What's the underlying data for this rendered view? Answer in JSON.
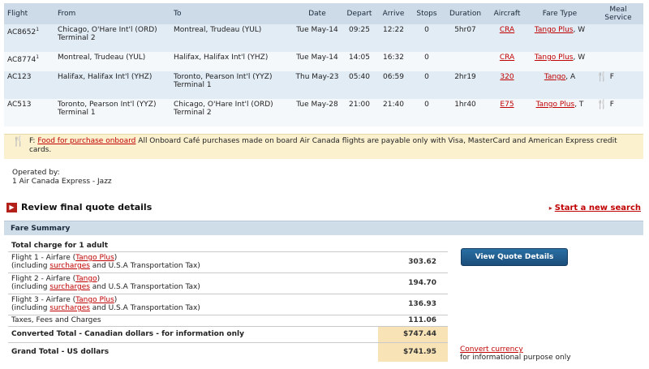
{
  "flights": {
    "headers": [
      "Flight",
      "From",
      "To",
      "Date",
      "Depart",
      "Arrive",
      "Stops",
      "Duration",
      "Aircraft",
      "Fare Type",
      "Meal Service"
    ],
    "rows": [
      {
        "flight": "AC8652",
        "sup": "1",
        "from": "Chicago, O'Hare Int'l (ORD)",
        "from2": "Terminal 2",
        "to": "Montreal, Trudeau (YUL)",
        "to2": "",
        "date": "Tue May-14",
        "depart": "09:25",
        "arrive": "12:22",
        "stops": "0",
        "duration": "5hr07",
        "aircraft": "CRA",
        "fare": "Tango Plus",
        "fare_class": ", W",
        "meal": ""
      },
      {
        "flight": "AC8774",
        "sup": "1",
        "from": "Montreal, Trudeau (YUL)",
        "from2": "",
        "to": "Halifax, Halifax Int'l (YHZ)",
        "to2": "",
        "date": "Tue May-14",
        "depart": "14:05",
        "arrive": "16:32",
        "stops": "0",
        "duration": "",
        "aircraft": "CRA",
        "fare": "Tango Plus",
        "fare_class": ", W",
        "meal": ""
      },
      {
        "flight": "AC123",
        "sup": "",
        "from": "Halifax, Halifax Int'l (YHZ)",
        "from2": "",
        "to": "Toronto, Pearson Int'l (YYZ)",
        "to2": "Terminal 1",
        "date": "Thu May-23",
        "depart": "05:40",
        "arrive": "06:59",
        "stops": "0",
        "duration": "2hr19",
        "aircraft": "320",
        "fare": "Tango",
        "fare_class": ", A",
        "meal": "F"
      },
      {
        "flight": "AC513",
        "sup": "",
        "from": "Toronto, Pearson Int'l (YYZ)",
        "from2": "Terminal 1",
        "to": "Chicago, O'Hare Int'l (ORD)",
        "to2": "Terminal 2",
        "date": "Tue May-28",
        "depart": "21:00",
        "arrive": "21:40",
        "stops": "0",
        "duration": "1hr40",
        "aircraft": "E75",
        "fare": "Tango Plus",
        "fare_class": ", T",
        "meal": "F"
      }
    ]
  },
  "meal_note": {
    "code": "F:",
    "link": "Food for purchase onboard",
    "text": "All Onboard Café purchases made on board Air Canada flights are payable only with Visa, MasterCard and American Express credit cards."
  },
  "operated": {
    "label": "Operated by:",
    "value": "1 Air Canada Express - Jazz"
  },
  "review": {
    "title": "Review final quote details",
    "new_search": "Start a new search"
  },
  "fare_summary": {
    "title": "Fare Summary",
    "total_charge_label": "Total charge for 1 adult",
    "lines": [
      {
        "pre": "Flight 1 - Airfare (",
        "fare": "Tango Plus",
        "post": ")",
        "pre2": "(including ",
        "link2": "surcharges",
        "post2": " and U.S.A Transportation Tax)",
        "amount": "303.62"
      },
      {
        "pre": "Flight 2 - Airfare (",
        "fare": "Tango",
        "post": ")",
        "pre2": "(including ",
        "link2": "surcharges",
        "post2": " and U.S.A Transportation Tax)",
        "amount": "194.70"
      },
      {
        "pre": "Flight 3 - Airfare (",
        "fare": "Tango Plus",
        "post": ")",
        "pre2": "(including ",
        "link2": "surcharges",
        "post2": " and U.S.A Transportation Tax)",
        "amount": "136.93"
      }
    ],
    "taxes_label": "Taxes, Fees and Charges",
    "taxes_amount": "111.06",
    "converted_label": "Converted Total - Canadian dollars - for information only",
    "converted_amount": "$747.44",
    "grand_label": "Grand Total - US dollars",
    "grand_amount": "$741.95",
    "view_button": "View Quote Details",
    "convert_link": "Convert currency",
    "convert_note": "for informational purpose only"
  }
}
